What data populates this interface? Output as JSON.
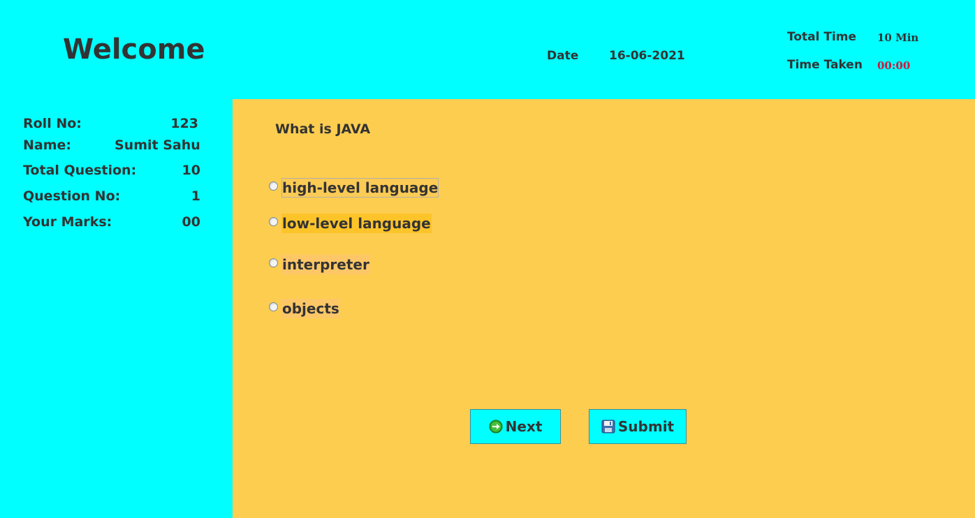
{
  "header": {
    "welcome": "Welcome",
    "date_label": "Date",
    "date_value": "16-06-2021",
    "total_time_label": "Total Time",
    "total_time_value": "10 Min",
    "time_taken_label": "Time Taken",
    "time_taken_value": "00:00"
  },
  "sidebar": {
    "roll_label": "Roll No:",
    "roll_value": "123",
    "name_label": "Name:",
    "name_value": "Sumit Sahu",
    "total_q_label": "Total Question:",
    "total_q_value": "10",
    "q_no_label": "Question No:",
    "q_no_value": "1",
    "marks_label": "Your Marks:",
    "marks_value": "00"
  },
  "question": {
    "text": "What is JAVA",
    "options": [
      "high-level language",
      "low-level language",
      "interpreter",
      "objects"
    ]
  },
  "buttons": {
    "next_label": "Next",
    "next_icon": "arrow-right-circle-icon",
    "submit_label": "Submit",
    "submit_icon": "floppy-disk-icon"
  },
  "colors": {
    "sidebar_bg": "#00ffff",
    "main_bg": "#fdcd50",
    "time_taken": "#cc1a3d",
    "text": "#333333"
  }
}
